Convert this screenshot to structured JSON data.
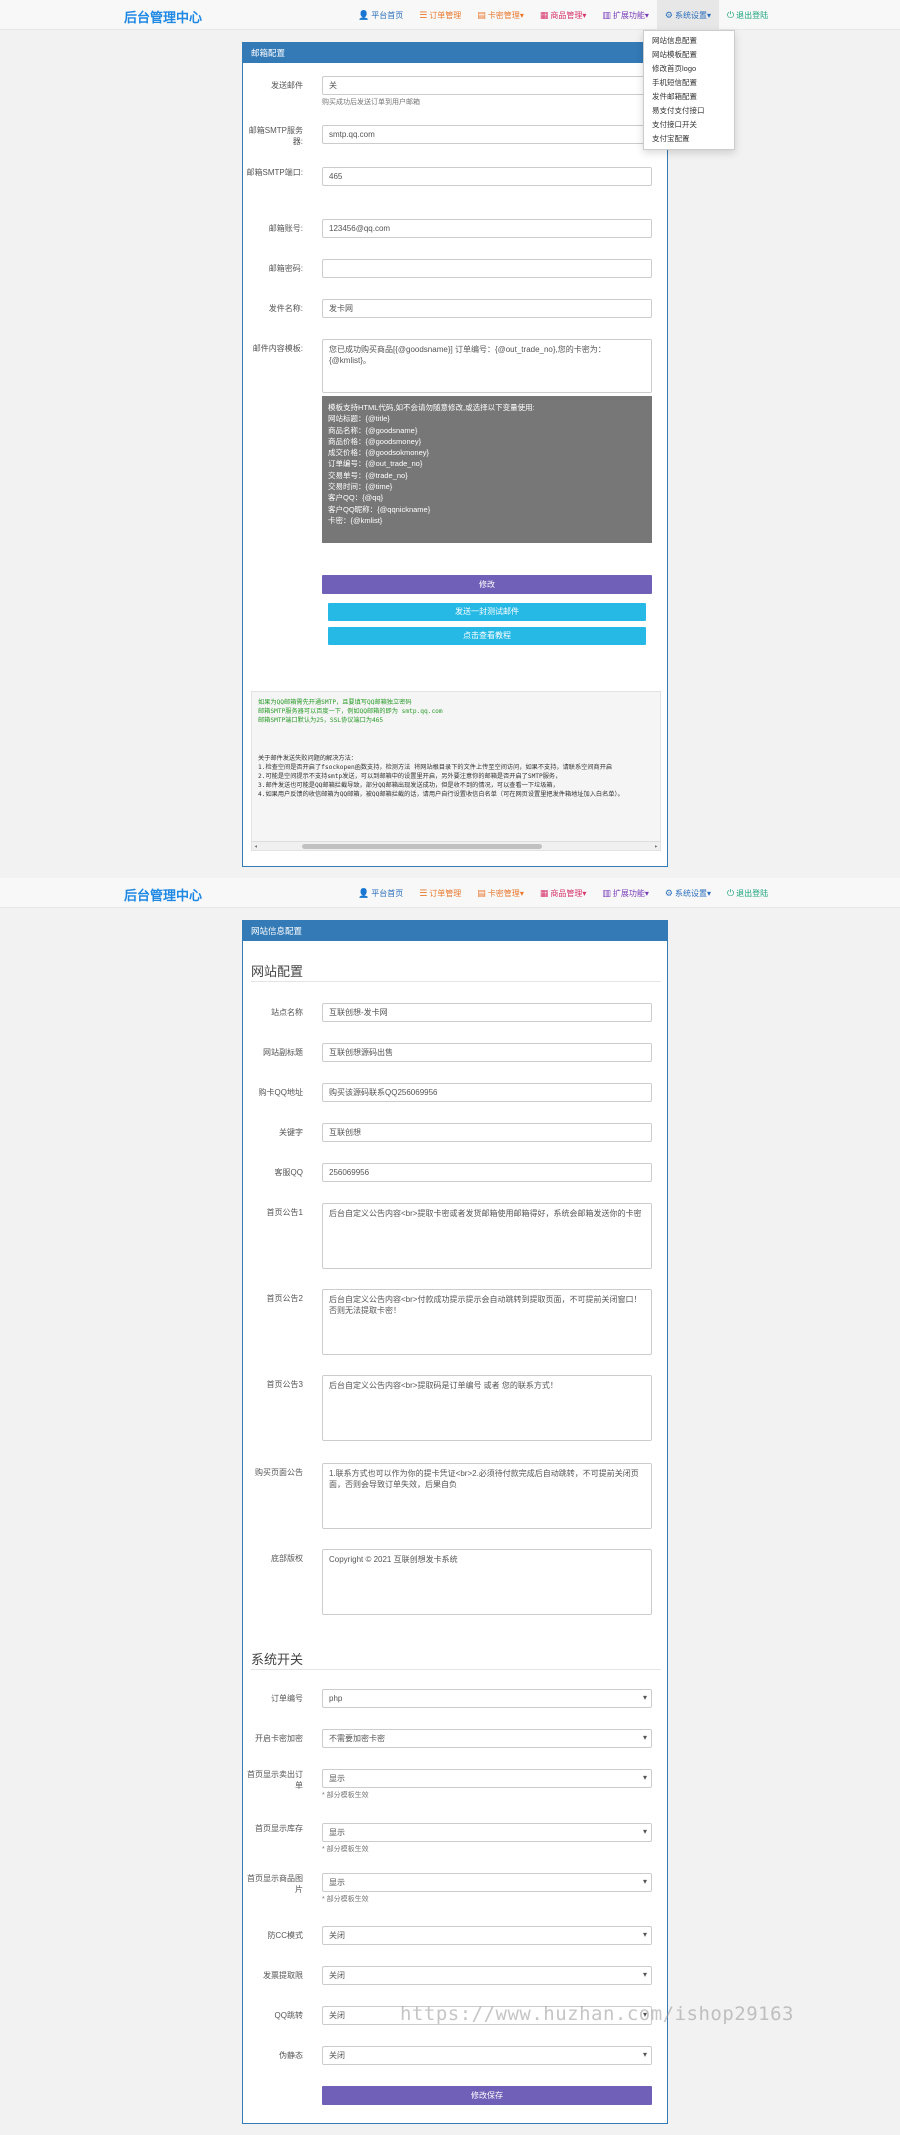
{
  "nav": {
    "brand": "后台管理中心",
    "items": [
      {
        "label": "平台首页",
        "icon": "user-icon",
        "glyph": "👤",
        "color": "c-blue"
      },
      {
        "label": "订单管理",
        "icon": "list-icon",
        "glyph": "☰",
        "color": "c-orange"
      },
      {
        "label": "卡密管理",
        "icon": "card-icon",
        "glyph": "▤",
        "color": "c-orange",
        "caret": "▾"
      },
      {
        "label": "商品管理",
        "icon": "grid-icon",
        "glyph": "▦",
        "color": "c-pink",
        "caret": "▾"
      },
      {
        "label": "扩展功能",
        "icon": "puzzle-icon",
        "glyph": "▥",
        "color": "c-purple",
        "caret": "▾"
      },
      {
        "label": "系统设置",
        "icon": "gear-icon",
        "glyph": "⚙",
        "color": "c-blue",
        "caret": "▾"
      },
      {
        "label": "退出登陆",
        "icon": "logout-icon",
        "glyph": "⏻",
        "color": "c-teal"
      }
    ]
  },
  "dropdown": {
    "items": [
      "网站信息配置",
      "网站模板配置",
      "修改首页logo",
      "手机短信配置",
      "发件邮箱配置",
      "易支付支付接口",
      "支付接口开关",
      "支付宝配置"
    ]
  },
  "mail": {
    "panel_title": "邮箱配置",
    "fields": {
      "send_mail": {
        "label": "发送邮件",
        "value": "关",
        "help": "购买成功后发送订单到用户邮箱"
      },
      "smtp_server": {
        "label": "邮箱SMTP服务器:",
        "value": "smtp.qq.com"
      },
      "smtp_port": {
        "label": "邮箱SMTP端口:",
        "value": "465"
      },
      "account": {
        "label": "邮箱账号:",
        "value": "123456@qq.com"
      },
      "password": {
        "label": "邮箱密码:",
        "value": ""
      },
      "sender": {
        "label": "发件名称:",
        "value": "发卡网"
      },
      "template": {
        "label": "邮件内容模板:",
        "value": "您已成功购买商品[{@goodsname}] 订单编号：{@out_trade_no},您的卡密为：{@kmlist}。"
      }
    },
    "vars_lines": [
      "模板支持HTML代码,如不会请勿随意修改,或选择以下变量使用:",
      "网站标题：{@title}",
      "商品名称：{@goodsname}",
      "商品价格：{@goodsmoney}",
      "成交价格：{@goodsokmoney}",
      "订单编号：{@out_trade_no}",
      "交易单号：{@trade_no}",
      "交易时间：{@time}",
      "客户QQ：{@qq}",
      "客户QQ昵称：{@qqnickname}",
      "卡密：{@kmlist}"
    ],
    "save_btn": "修改",
    "test_btn": "发送一封测试邮件",
    "query_btn": "点击查看教程",
    "code_lines_green": [
      "如果为QQ邮箱需先开通SMTP，且要填写QQ邮箱独立密码",
      "邮箱SMTP服务器可以百度一下，例如QQ邮箱的即为 smtp.qq.com",
      "邮箱SMTP端口默认为25，SSL协议端口为465"
    ],
    "code_lines": [
      "关于邮件发送失败问题的解决方法：",
      "1.检查空间是否开启了fsockopen函数支持，检测方法 将网站根目录下的文件上传至空间访问，如果不支持，请联系空间商开启",
      "2.可能是空间提示不支持smtp发送，可以到邮箱中的设置里开启，另外要注意你的邮箱是否开启了SMTP服务，",
      "3.邮件发送也可能是QQ邮箱拦截导致，部分QQ邮箱出现发送成功，但是收不到的情况，可以查看一下垃圾箱，",
      "4.如果用户反馈的收信邮箱为QQ邮箱，被QQ邮箱拦截的话，请用户自行设置收信白名单（可在网页设置里把发件箱地址加入白名单）。"
    ]
  },
  "nav2": {
    "brand": "后台管理中心"
  },
  "site": {
    "panel_title": "网站信息配置",
    "section1": "网站配置",
    "fields": {
      "site_name": {
        "label": "站点名称",
        "value": "互联创想-发卡网"
      },
      "site_title": {
        "label": "网站副标题",
        "value": "互联创想源码出售"
      },
      "purchase_url": {
        "label": "购卡QQ地址",
        "value": "购买该源码联系QQ256069956"
      },
      "keywords": {
        "label": "关键字",
        "value": "互联创想"
      },
      "qq": {
        "label": "客服QQ",
        "value": "256069956"
      },
      "notice1": {
        "label": "首页公告1",
        "value": "后台自定义公告内容<br>提取卡密或者发货邮箱使用邮箱得好，系统会邮箱发送你的卡密"
      },
      "notice2": {
        "label": "首页公告2",
        "value": "后台自定义公告内容<br>付款成功提示提示会自动跳转到提取页面，不可提前关闭窗口！否则无法提取卡密！"
      },
      "notice3": {
        "label": "首页公告3",
        "value": "后台自定义公告内容<br>提取码是订单编号 或者 您的联系方式！"
      },
      "pay_notice": {
        "label": "购买页面公告",
        "value": "1.联系方式也可以作为你的提卡凭证<br>2.必须待付款完成后自动跳转，不可提前关闭页面，否则会导致订单失效，后果自负"
      },
      "copyright": {
        "label": "底部版权",
        "value": "Copyright © 2021 互联创想发卡系统"
      }
    },
    "section2": "系统开关",
    "switches": [
      {
        "label": "订单编号",
        "value": "php",
        "help": ""
      },
      {
        "label": "开启卡密加密",
        "value": "不需要加密卡密",
        "help": ""
      },
      {
        "label": "首页显示卖出订单",
        "value": "显示",
        "help": "* 部分模板生效"
      },
      {
        "label": "首页显示库存",
        "value": "显示",
        "help": "* 部分模板生效"
      },
      {
        "label": "首页显示商品图片",
        "value": "显示",
        "help": "* 部分模板生效"
      },
      {
        "label": "防CC模式",
        "value": "关闭",
        "help": ""
      },
      {
        "label": "发票提取限",
        "value": "关闭",
        "help": ""
      },
      {
        "label": "QQ跳转",
        "value": "关闭",
        "help": ""
      },
      {
        "label": "伪静态",
        "value": "关闭",
        "help": ""
      }
    ],
    "save_btn": "修改保存"
  },
  "watermark": "https://www.huzhan.com/ishop29163"
}
